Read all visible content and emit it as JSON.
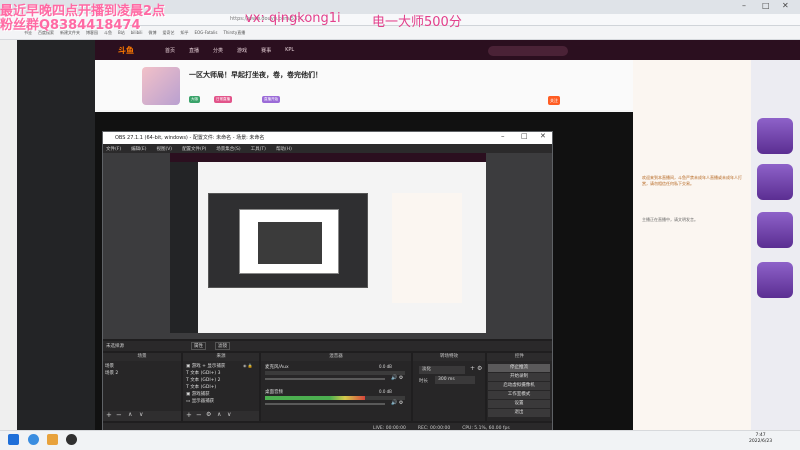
{
  "browser": {
    "url": "https://www.douyu.com/537...",
    "bookmarks": [
      "书签",
      "百度搜索",
      "新建文件夹",
      "博客园",
      "斗鱼",
      "B站",
      "bilibili",
      "微博",
      "爱奇艺",
      "知乎",
      "EOG-Fatalis",
      "Thirsty直播"
    ]
  },
  "overlay": {
    "line1": "最近早晚四点开播到凌晨2点",
    "line2": "粉丝群Q8384418474",
    "vx": "vx: qingkong1i",
    "promo": "电一大师500分"
  },
  "site": {
    "logo": "斗鱼",
    "nav": [
      "首页",
      "直播",
      "分类",
      "游戏",
      "赛事",
      "KPL"
    ],
    "room_title": "一区大师局！早起打坐夜，卷，卷完他们！",
    "chips": [
      "大咖",
      "日常直播",
      "直播开始"
    ],
    "follow": "关注",
    "chat_lines": [
      "欢迎来到本直播间，斗鱼严禁未成年人直播或未成年人打赏，请勿相信任何私下交易。",
      "主播正在直播中，请文明发言。"
    ]
  },
  "obs": {
    "title": "OBS 27.1.1 (64-bit, windows) - 配置文件: 未命名 - 场景: 未命名",
    "menu": [
      "文件(F)",
      "编辑(E)",
      "视图(V)",
      "配置文件(P)",
      "场景集合(S)",
      "工具(T)",
      "帮助(H)"
    ],
    "no_source": "未选择源",
    "properties_btn": "属性",
    "filters_btn": "滤镜",
    "docks": {
      "scenes": "场景",
      "sources": "来源",
      "mixer": "混音器",
      "transitions": "转场特效",
      "controls": "控件"
    },
    "scenes": [
      "场景",
      "场景 2"
    ],
    "sources": [
      "游戏 + 显示捕获",
      "文本 (GDI+) 3",
      "文本 (GDI+) 2",
      "文本 (GDI+)",
      "游戏捕获",
      "显示器捕获"
    ],
    "mixer": [
      {
        "name": "桌面音频",
        "db": "0.0 dB"
      },
      {
        "name": "麦克风/Aux",
        "db": "0.0 dB"
      }
    ],
    "transition": {
      "type": "淡化",
      "duration_label": "时长",
      "duration": "300 ms"
    },
    "controls": [
      "停止推流",
      "开始录制",
      "启动虚拟摄像机",
      "工作室模式",
      "设置",
      "退出"
    ],
    "status": {
      "live": "LIVE: 00:00:00",
      "rec": "REC: 00:00:00",
      "cpu": "CPU: 5.1%, 60.00 fps"
    }
  },
  "taskbar": {
    "time": "7:47",
    "date": "2022/6/23"
  }
}
